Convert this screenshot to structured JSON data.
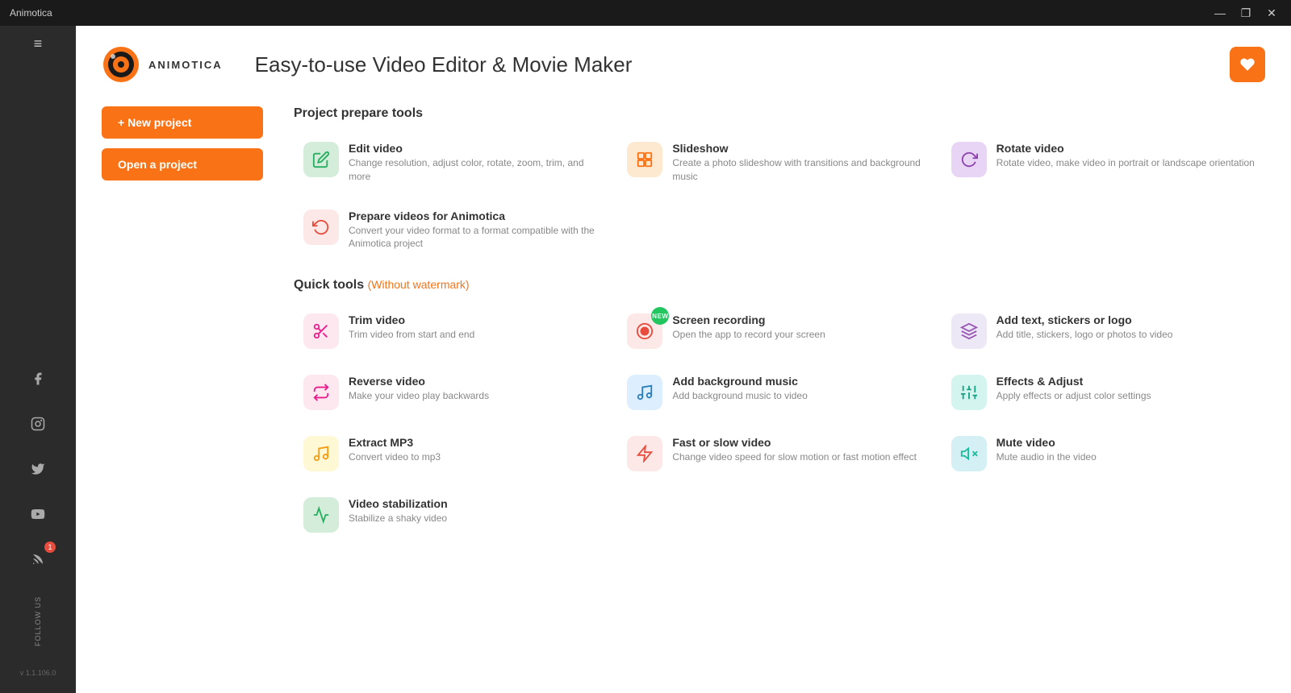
{
  "titleBar": {
    "title": "Animotica",
    "minimize": "—",
    "maximize": "❐",
    "close": "✕"
  },
  "sidebar": {
    "menuIcon": "≡",
    "socials": [
      {
        "name": "facebook",
        "icon": "f",
        "badge": null
      },
      {
        "name": "instagram",
        "icon": "◎",
        "badge": null
      },
      {
        "name": "twitter",
        "icon": "✦",
        "badge": null
      },
      {
        "name": "youtube",
        "icon": "▶",
        "badge": null
      },
      {
        "name": "rss",
        "icon": "◉",
        "badge": "1"
      }
    ],
    "followUs": "FOLLOW US",
    "version": "v 1.1.106.0"
  },
  "header": {
    "logoText": "ANIMOTICA",
    "title": "Easy-to-use Video Editor & Movie Maker",
    "feedbackIcon": "♥"
  },
  "projectTools": {
    "sectionTitle": "Project prepare tools",
    "newProject": "+ New project",
    "openProject": "Open a project"
  },
  "prepareTools": [
    {
      "id": "edit-video",
      "name": "Edit video",
      "desc": "Change resolution, adjust color, rotate, zoom, trim, and more",
      "iconColor": "icon-green",
      "icon": "✎",
      "newBadge": false
    },
    {
      "id": "slideshow",
      "name": "Slideshow",
      "desc": "Create a photo slideshow with transitions and background music",
      "iconColor": "icon-orange",
      "icon": "▦",
      "newBadge": false
    },
    {
      "id": "rotate-video",
      "name": "Rotate video",
      "desc": "Rotate video, make video in portrait or landscape orientation",
      "iconColor": "icon-purple",
      "icon": "↻",
      "newBadge": false
    },
    {
      "id": "prepare-videos",
      "name": "Prepare videos for Animotica",
      "desc": "Convert your video format to a format compatible with the Animotica project",
      "iconColor": "icon-red-light",
      "icon": "↺",
      "newBadge": false
    }
  ],
  "quickTools": {
    "sectionTitle": "Quick tools",
    "watermarkNote": "(Without watermark)"
  },
  "quickToolsList": [
    {
      "id": "trim-video",
      "name": "Trim video",
      "desc": "Trim video from start and end",
      "iconColor": "icon-pink",
      "icon": "✂",
      "newBadge": false
    },
    {
      "id": "screen-recording",
      "name": "Screen recording",
      "desc": "Open the app to record your screen",
      "iconColor": "icon-red",
      "icon": "⏺",
      "newBadge": true
    },
    {
      "id": "add-text",
      "name": "Add text, stickers or logo",
      "desc": "Add title, stickers, logo or photos to video",
      "iconColor": "icon-violet",
      "icon": "⊕",
      "newBadge": false
    },
    {
      "id": "reverse-video",
      "name": "Reverse video",
      "desc": "Make your video play backwards",
      "iconColor": "icon-pink",
      "icon": "⇄",
      "newBadge": false
    },
    {
      "id": "add-background-music",
      "name": "Add background music",
      "desc": "Add background music to video",
      "iconColor": "icon-blue-light",
      "icon": "♫",
      "newBadge": false
    },
    {
      "id": "effects-adjust",
      "name": "Effects & Adjust",
      "desc": "Apply effects or adjust color settings",
      "iconColor": "icon-teal",
      "icon": "⊞",
      "newBadge": false
    },
    {
      "id": "extract-mp3",
      "name": "Extract MP3",
      "desc": "Convert video to mp3",
      "iconColor": "icon-yellow",
      "icon": "♪",
      "newBadge": false
    },
    {
      "id": "fast-slow-video",
      "name": "Fast or slow video",
      "desc": "Change video speed for slow motion or fast motion effect",
      "iconColor": "icon-red-light",
      "icon": "⏩",
      "newBadge": false
    },
    {
      "id": "mute-video",
      "name": "Mute video",
      "desc": "Mute audio in the video",
      "iconColor": "icon-cyan",
      "icon": "🔇",
      "newBadge": false
    },
    {
      "id": "video-stabilization",
      "name": "Video stabilization",
      "desc": "Stabilize a shaky video",
      "iconColor": "icon-green",
      "icon": "✦",
      "newBadge": false
    }
  ]
}
